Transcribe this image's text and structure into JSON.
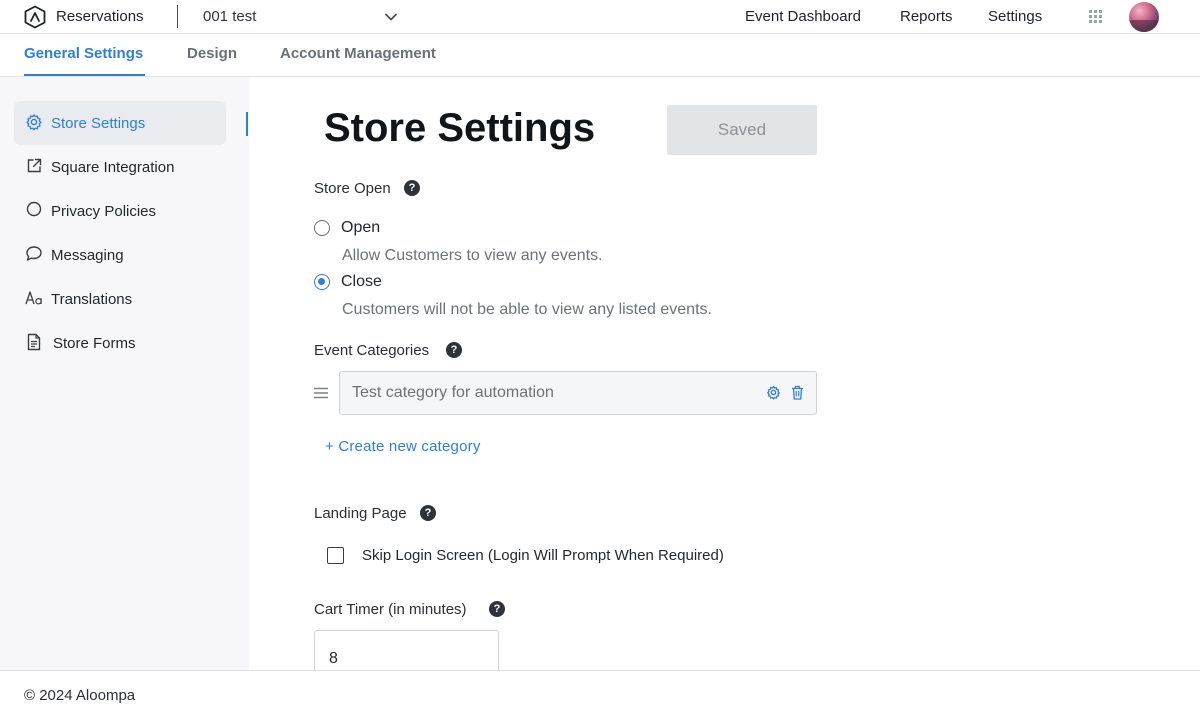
{
  "app": {
    "title": "Reservations",
    "store_name": "001 test"
  },
  "topnav": {
    "items": [
      "Event Dashboard",
      "Reports",
      "Settings"
    ]
  },
  "tabs": [
    {
      "label": "General Settings",
      "active": true
    },
    {
      "label": "Design",
      "active": false
    },
    {
      "label": "Account Management",
      "active": false
    }
  ],
  "sidebar": {
    "items": [
      {
        "label": "Store Settings",
        "icon": "gear-icon",
        "active": true
      },
      {
        "label": "Square Integration",
        "icon": "external-link-icon",
        "active": false
      },
      {
        "label": "Privacy Policies",
        "icon": "circle-icon",
        "active": false
      },
      {
        "label": "Messaging",
        "icon": "chat-bubble-icon",
        "active": false
      },
      {
        "label": "Translations",
        "icon": "text-size-icon",
        "active": false
      },
      {
        "label": "Store Forms",
        "icon": "document-icon",
        "active": false
      }
    ]
  },
  "main": {
    "title": "Store Settings",
    "saved_label": "Saved",
    "store_open": {
      "label": "Store Open",
      "options": [
        {
          "label": "Open",
          "description": "Allow Customers to view any events.",
          "selected": false
        },
        {
          "label": "Close",
          "description": "Customers will not be able to view any listed events.",
          "selected": true
        }
      ]
    },
    "event_categories": {
      "label": "Event Categories",
      "items": [
        "Test category for automation"
      ],
      "create_label": "+ Create new category"
    },
    "landing_page": {
      "label": "Landing Page",
      "checkbox_label": "Skip Login Screen (Login Will Prompt When Required)",
      "checked": false
    },
    "cart_timer": {
      "label": "Cart Timer (in minutes)",
      "value": "8"
    },
    "help_glyph": "?"
  },
  "footer": {
    "copyright": "© 2024 Aloompa"
  },
  "colors": {
    "accent": "#2f7fd9",
    "sidebar_bg": "#f7f7f9",
    "button_disabled_bg": "#e3e4e6"
  }
}
